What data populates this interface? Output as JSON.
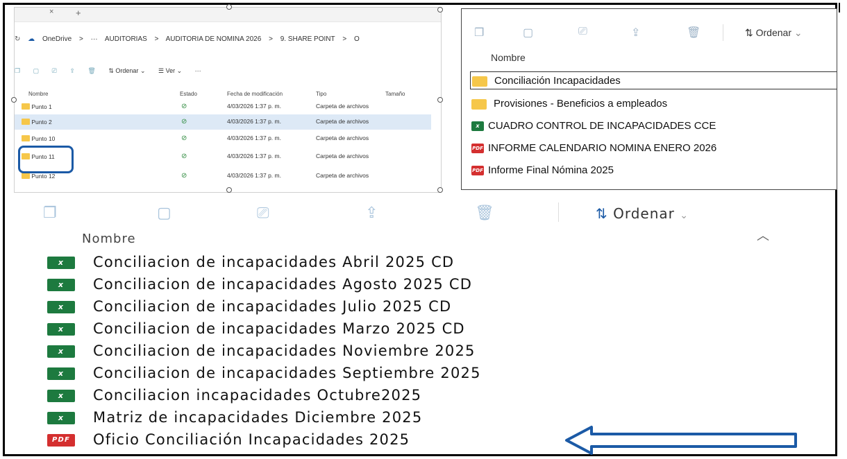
{
  "explorer_small": {
    "tab_close": "×",
    "tab_add": "+",
    "breadcrumb": [
      "OneDrive",
      ">",
      "···",
      "AUDITORIAS",
      ">",
      "AUDITORIA DE NOMINA 2026",
      ">",
      "9. SHARE POINT",
      ">",
      "O"
    ],
    "toolbar": {
      "sort_label": "Ordenar",
      "view_label": "Ver",
      "more": "···"
    },
    "columns": {
      "name": "Nombre",
      "status": "Estado",
      "modified": "Fecha de modificación",
      "type": "Tipo",
      "size": "Tamaño"
    },
    "rows": [
      {
        "name": "Punto 1",
        "modified": "4/03/2026 1:37 p. m.",
        "type": "Carpeta de archivos"
      },
      {
        "name": "Punto 2",
        "modified": "4/03/2026 1:37 p. m.",
        "type": "Carpeta de archivos"
      },
      {
        "name": "Punto 10",
        "modified": "4/03/2026 1:37 p. m.",
        "type": "Carpeta de archivos"
      },
      {
        "name": "Punto 11",
        "modified": "4/03/2026 1:37 p. m.",
        "type": "Carpeta de archivos"
      },
      {
        "name": "Punto 12",
        "modified": "4/03/2026 1:37 p. m.",
        "type": "Carpeta de archivos"
      }
    ]
  },
  "panel_top_right": {
    "sort_label": "Ordenar",
    "column_name": "Nombre",
    "items": [
      {
        "name": "Conciliación  Incapacidades",
        "kind": "folder"
      },
      {
        "name": "Provisiones - Beneficios a empleados",
        "kind": "folder"
      },
      {
        "name": "CUADRO CONTROL DE INCAPACIDADES CCE",
        "kind": "excel"
      },
      {
        "name": "INFORME CALENDARIO NOMINA ENERO 2026",
        "kind": "pdf"
      },
      {
        "name": "Informe Final Nómina 2025",
        "kind": "pdf"
      }
    ]
  },
  "panel_bottom": {
    "sort_label": "Ordenar",
    "column_name": "Nombre",
    "files": [
      {
        "name": "Conciliacion de incapacidades Abril 2025 CD",
        "kind": "excel"
      },
      {
        "name": "Conciliacion de incapacidades Agosto 2025 CD",
        "kind": "excel"
      },
      {
        "name": "Conciliacion de incapacidades Julio 2025 CD",
        "kind": "excel"
      },
      {
        "name": "Conciliacion de incapacidades Marzo 2025 CD",
        "kind": "excel"
      },
      {
        "name": "Conciliacion de incapacidades Noviembre 2025",
        "kind": "excel"
      },
      {
        "name": "Conciliacion de incapacidades Septiembre 2025",
        "kind": "excel"
      },
      {
        "name": "Conciliacion incapacidades Octubre2025",
        "kind": "excel"
      },
      {
        "name": "Matriz de incapacidades Diciembre 2025",
        "kind": "excel"
      },
      {
        "name": "Oficio Conciliación Incapacidades 2025",
        "kind": "pdf"
      }
    ]
  },
  "colors": {
    "highlight": "#1b5aa6",
    "folder": "#f6c74a",
    "excel": "#1d7a3f",
    "pdf": "#d42f2f"
  },
  "icon_labels": {
    "pdf": "PDF",
    "excel": "x"
  }
}
